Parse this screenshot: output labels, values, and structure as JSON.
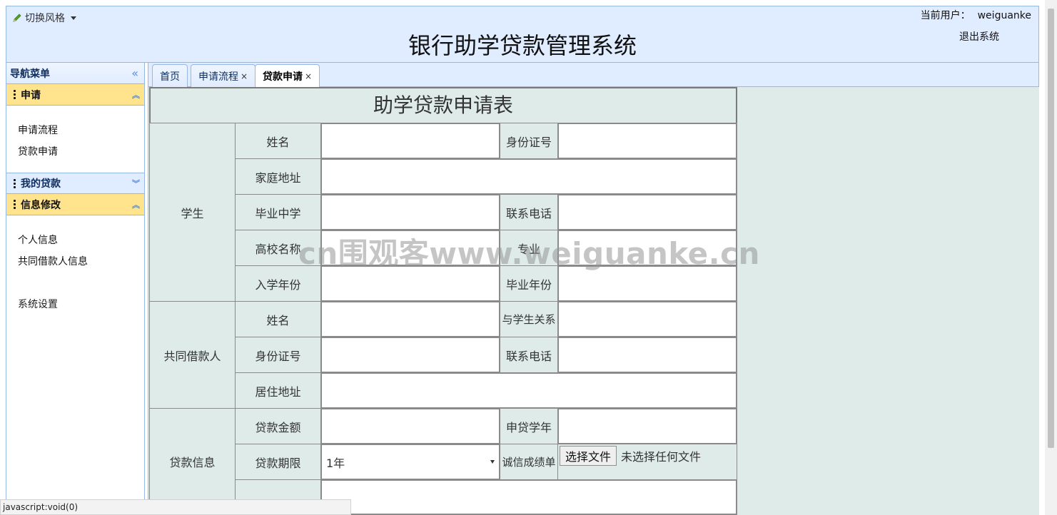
{
  "header": {
    "style_switch": "切换风格",
    "title": "银行助学贷款管理系统",
    "user_label": "当前用户：",
    "username": "weiguanke",
    "logout": "退出系统"
  },
  "sidebar": {
    "title": "导航菜单",
    "groups": [
      {
        "title": "申请",
        "items": [
          "申请流程",
          "贷款申请"
        ]
      },
      {
        "title": "我的贷款"
      },
      {
        "title": "信息修改",
        "items": [
          "个人信息",
          "共同借款人信息"
        ],
        "extra": "系统设置"
      }
    ]
  },
  "tabs": [
    {
      "label": "首页"
    },
    {
      "label": "申请流程",
      "close": "×"
    },
    {
      "label": "贷款申请",
      "close": "×"
    }
  ],
  "form": {
    "title": "助学贷款申请表",
    "sections": {
      "student": "学生",
      "coborrower": "共同借款人",
      "loan": "贷款信息"
    },
    "labels": {
      "name": "姓名",
      "id_no": "身份证号",
      "home_addr": "家庭地址",
      "high_school": "毕业中学",
      "phone": "联系电话",
      "college": "高校名称",
      "major": "专业",
      "entry_year": "入学年份",
      "grad_year": "毕业年份",
      "co_name": "姓名",
      "relation": "与学生关系",
      "co_id": "身份证号",
      "co_phone": "联系电话",
      "residence": "居住地址",
      "amount": "贷款金额",
      "apply_year": "申贷学年",
      "term": "贷款期限",
      "credit": "诚信成绩单"
    },
    "term_value": "1年",
    "file_button": "选择文件",
    "file_status": "未选择任何文件"
  },
  "watermark": "cn围观客www.weiguanke.cn",
  "status_bar": "javascript:void(0)"
}
